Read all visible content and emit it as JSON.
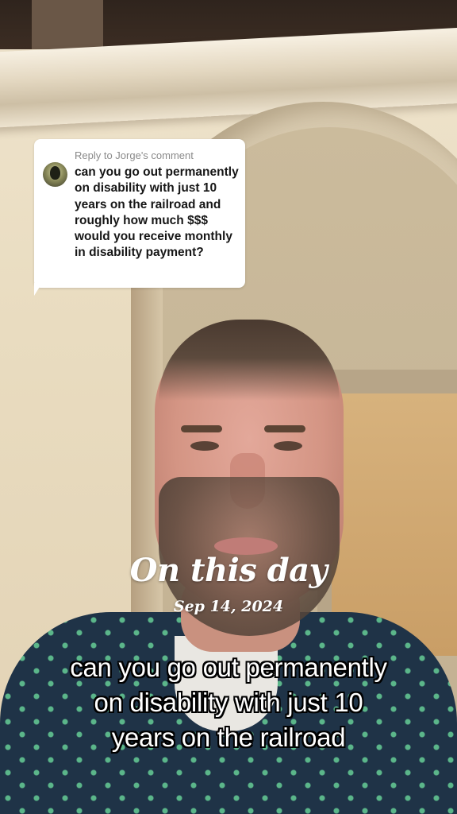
{
  "reply": {
    "header": "Reply to Jorge's comment",
    "text": "can you go out permanently on disability with just 10 years on the railroad and roughly how much $$$ would you receive monthly in disability payment?"
  },
  "memory": {
    "title": "On this day",
    "date": "Sep 14, 2024"
  },
  "caption": {
    "lines": [
      "can you go out permanently",
      "on disability with just 10",
      "years on the railroad"
    ]
  },
  "colors": {
    "bubble": "#ffffff",
    "caption_text": "#ffffff",
    "caption_outline": "#000000"
  }
}
